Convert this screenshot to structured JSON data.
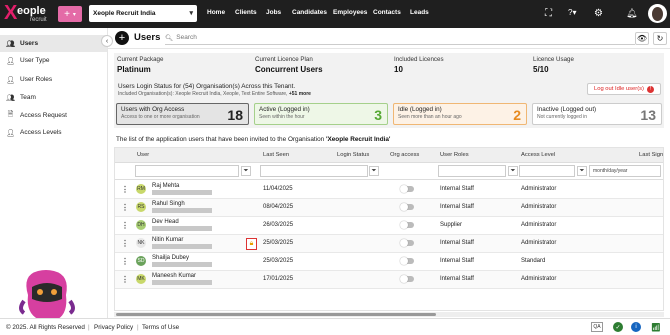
{
  "topbar": {
    "logo_x": "X",
    "logo_word": "eople",
    "logo_sub": "recruit",
    "plus_label": "+",
    "org_select": "Xeople Recruit India",
    "nav": [
      "Home",
      "Clients",
      "Jobs",
      "Candidates",
      "Employees",
      "Contacts",
      "Leads"
    ],
    "icons": [
      "fullscreen-icon",
      "grid-icon",
      "help-icon",
      "settings-icon",
      "bell-icon",
      "avatar"
    ]
  },
  "sidebar": {
    "items": [
      {
        "label": "Users",
        "icon": "users-icon",
        "active": true
      },
      {
        "label": "User Type",
        "icon": "user-type-icon"
      },
      {
        "label": "User Roles",
        "icon": "user-roles-icon"
      },
      {
        "label": "Team",
        "icon": "team-icon"
      },
      {
        "label": "Access Request",
        "icon": "access-request-icon"
      },
      {
        "label": "Access Levels",
        "icon": "access-levels-icon"
      }
    ]
  },
  "header": {
    "title": "Users",
    "search_placeholder": "Search"
  },
  "summary": {
    "package_label": "Current Package",
    "package_value": "Platinum",
    "plan_label": "Current Licence Plan",
    "plan_value": "Concurrent Users",
    "included_label": "Included Licences",
    "included_value": "10",
    "usage_label": "Licence Usage",
    "usage_value": "5/10",
    "status_line": "Users Login Status for (54) Organisation(s) Across this Tenant.",
    "included_orgs": "Included Organisation(s): Xeople Recruit India, Xeople, Text Entire Software,",
    "more": "+51 more",
    "logout_label": "Log out Idle user(s)",
    "logout_badge": "!"
  },
  "cards": [
    {
      "title": "Users with Org Access",
      "sub": "Access to one or more organisation",
      "count": "18",
      "style": "active"
    },
    {
      "title": "Active (Logged in)",
      "sub": "Seen within the hour",
      "count": "3",
      "style": "green"
    },
    {
      "title": "Idle (Logged in)",
      "sub": "Seen more than an hour ago",
      "count": "2",
      "style": "orange"
    },
    {
      "title": "Inactive (Logged out)",
      "sub": "Not currently logged in",
      "count": "13",
      "style": "grey"
    }
  ],
  "list_line_prefix": "The list of the application users that have been invited to the Organisation ",
  "list_line_org": "'Xeople Recruit India'",
  "table": {
    "columns": [
      "User",
      "Last Seen",
      "Login Status",
      "Org access",
      "User Roles",
      "Access Level",
      "Last Sign"
    ],
    "date_filter_placeholder": "month/day/year",
    "rows": [
      {
        "initials": "RM",
        "name": "Raj Mehta",
        "last_seen": "11/04/2025",
        "role": "Internal Staff",
        "access": "Administrator",
        "locked": false
      },
      {
        "initials": "RS",
        "name": "Rahul Singh",
        "last_seen": "08/04/2025",
        "role": "Internal Staff",
        "access": "Administrator",
        "locked": false
      },
      {
        "initials": "DH",
        "name": "Dev Head",
        "last_seen": "26/03/2025",
        "role": "Supplier",
        "access": "Administrator",
        "locked": false
      },
      {
        "initials": "NK",
        "name": "Nitin Kumar",
        "last_seen": "25/03/2025",
        "role": "Internal Staff",
        "access": "Administrator",
        "locked": true
      },
      {
        "initials": "SD",
        "name": "Shailja Dubey",
        "last_seen": "25/03/2025",
        "role": "Internal Staff",
        "access": "Standard",
        "locked": false
      },
      {
        "initials": "MK",
        "name": "Maneesh Kumar",
        "last_seen": "17/01/2025",
        "role": "Internal Staff",
        "access": "Administrator",
        "locked": false
      }
    ]
  },
  "footer": {
    "copyright": "© 2025. All Rights Reserved",
    "privacy": "Privacy Policy",
    "terms": "Terms of Use",
    "qa": "QA"
  }
}
